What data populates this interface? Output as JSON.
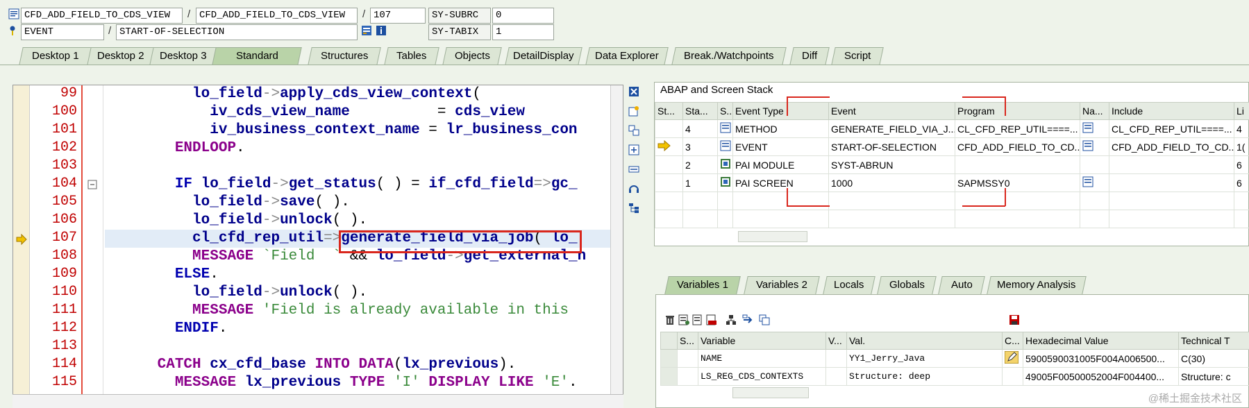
{
  "header": {
    "program_1": "CFD_ADD_FIELD_TO_CDS_VIEW",
    "program_2": "CFD_ADD_FIELD_TO_CDS_VIEW",
    "line": "107",
    "subrc_label": "SY-SUBRC",
    "subrc_value": "0",
    "event_type": "EVENT",
    "event_name": "START-OF-SELECTION",
    "tabix_label": "SY-TABIX",
    "tabix_value": "1",
    "sep1": "/",
    "sep2": "/",
    "sep3": "/"
  },
  "tabs": [
    "Desktop 1",
    "Desktop 2",
    "Desktop 3",
    "Standard",
    "Structures",
    "Tables",
    "Objects",
    "DetailDisplay",
    "Data Explorer",
    "Break./Watchpoints",
    "Diff",
    "Script"
  ],
  "active_tab": "Standard",
  "editor": {
    "line_numbers": [
      "99",
      "100",
      "101",
      "102",
      "103",
      "104",
      "105",
      "106",
      "107",
      "108",
      "109",
      "110",
      "111",
      "112",
      "113",
      "114",
      "115"
    ],
    "current_line": "107"
  },
  "stack": {
    "title": "ABAP and Screen Stack",
    "columns": [
      "St...",
      "Sta...",
      "S..",
      "Event Type",
      "Event",
      "Program",
      "Na...",
      "Include",
      "Li"
    ],
    "rows": [
      {
        "level": "4",
        "type": "METHOD",
        "event": "GENERATE_FIELD_VIA_J...",
        "program": "CL_CFD_REP_UTIL====...",
        "include": "CL_CFD_REP_UTIL====...",
        "line": "4"
      },
      {
        "level": "3",
        "type": "EVENT",
        "event": "START-OF-SELECTION",
        "program": "CFD_ADD_FIELD_TO_CD...",
        "include": "CFD_ADD_FIELD_TO_CD...",
        "line": "1("
      },
      {
        "level": "2",
        "type": "PAI MODULE",
        "event": "SYST-ABRUN",
        "program": "",
        "include": "",
        "line": "6"
      },
      {
        "level": "1",
        "type": "PAI SCREEN",
        "event": "1000",
        "program": "SAPMSSY0",
        "include": "",
        "line": "6"
      }
    ]
  },
  "var_tabs": [
    "Variables 1",
    "Variables 2",
    "Locals",
    "Globals",
    "Auto",
    "Memory Analysis"
  ],
  "variables": {
    "columns": [
      "S...",
      "Variable",
      "V...",
      "Val.",
      "C...",
      "Hexadecimal Value",
      "Technical T"
    ],
    "rows": [
      {
        "name": "NAME",
        "value": "YY1_Jerry_Java",
        "hex": "5900590031005F004A006500...",
        "tech": "C(30)"
      },
      {
        "name": "LS_REG_CDS_CONTEXTS",
        "value": "Structure: deep",
        "hex": "49005F00500052004F004400...",
        "tech": "Structure: c"
      }
    ]
  },
  "watermark": "@稀土掘金技术社区",
  "colors": {
    "accent_red": "#d9261c",
    "tab_active": "#b9d3a8",
    "line_highlight": "#e2ecf7"
  }
}
